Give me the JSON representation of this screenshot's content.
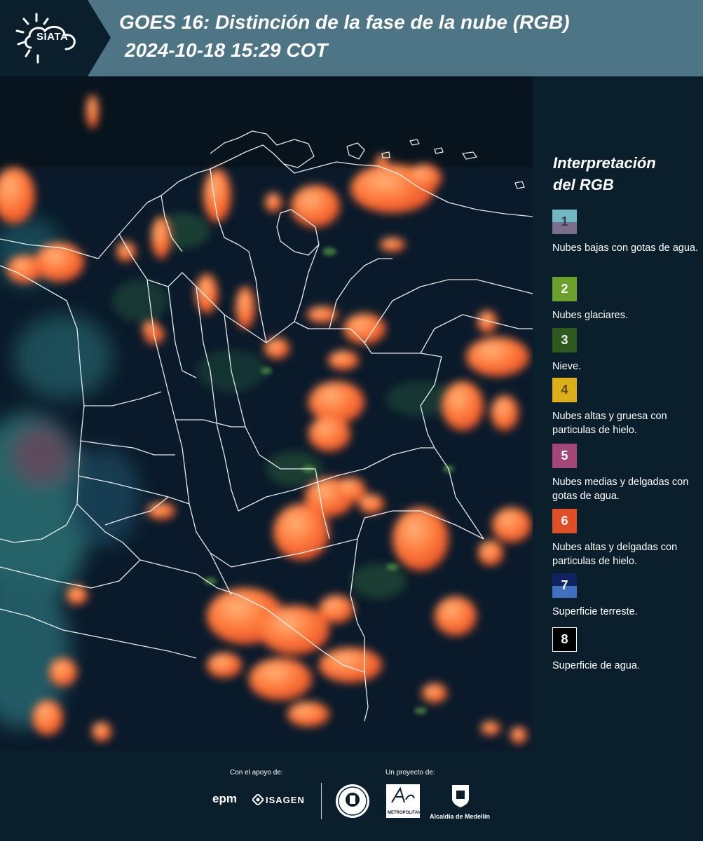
{
  "header": {
    "logo_text": "SIATA",
    "title_line1": "GOES 16: Distinción de la fase de la nube (RGB)",
    "title_line2": "2024-10-18 15:29 COT",
    "background": "#4e7585"
  },
  "legend": {
    "title_line1": "Interpretación",
    "title_line2": "del RGB",
    "items": [
      {
        "num": "1",
        "label": "Nubes bajas con gotas de agua.",
        "colors": [
          "#6fb8c4",
          "#7a6f8c"
        ]
      },
      {
        "num": "2",
        "label": "Nubes glaciares.",
        "colors": [
          "#6aa12c"
        ]
      },
      {
        "num": "3",
        "label": "Nieve.",
        "colors": [
          "#2e5a1e"
        ]
      },
      {
        "num": "4",
        "label": "Nubes altas y gruesa con particulas de hielo.",
        "colors": [
          "#dcae1a"
        ]
      },
      {
        "num": "5",
        "label": "Nubes medias y delgadas con gotas de agua.",
        "colors": [
          "#a44777"
        ]
      },
      {
        "num": "6",
        "label": "Nubes altas y delgadas con particulas de hielo.",
        "colors": [
          "#e04e26"
        ]
      },
      {
        "num": "7",
        "label": "Superficie terreste.",
        "colors": [
          "#0f2360",
          "#4270c0"
        ]
      },
      {
        "num": "8",
        "label": "Superficie de agua.",
        "colors": [
          "#000000"
        ]
      }
    ]
  },
  "footer": {
    "support_label": "Con el apoyo de:",
    "project_label": "Un proyecto de:",
    "sponsor1": "epm",
    "sponsor2": "ISAGEN",
    "partner2_caption": "METROPOLITANA",
    "partner3_caption": "Alcaldía de Medellín"
  }
}
